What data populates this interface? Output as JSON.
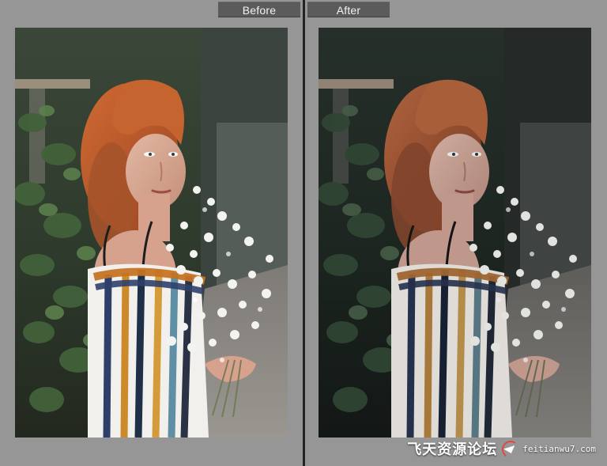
{
  "compare": {
    "before_label": "Before",
    "after_label": "After"
  },
  "watermark": {
    "brand_cn": "飞天资源论坛",
    "domain": "feitianwu7.com"
  },
  "colors": {
    "background": "#919191",
    "label_background": "#5b5b5b",
    "label_text": "#f2f2f2",
    "divider": "#232323"
  }
}
